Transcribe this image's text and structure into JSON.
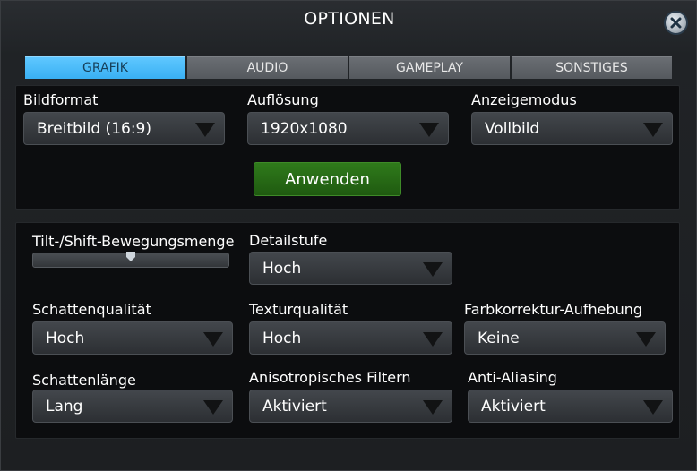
{
  "window": {
    "title": "OPTIONEN"
  },
  "tabs": [
    {
      "label": "GRAFIK",
      "active": true
    },
    {
      "label": "AUDIO",
      "active": false
    },
    {
      "label": "GAMEPLAY",
      "active": false
    },
    {
      "label": "SONSTIGES",
      "active": false
    }
  ],
  "display": {
    "aspect": {
      "label": "Bildformat",
      "value": "Breitbild (16:9)"
    },
    "resolution": {
      "label": "Auflösung",
      "value": "1920x1080"
    },
    "mode": {
      "label": "Anzeigemodus",
      "value": "Vollbild"
    },
    "apply_label": "Anwenden"
  },
  "quality": {
    "tiltshift": {
      "label": "Tilt-/Shift-Bewegungsmenge",
      "fraction": 0.5
    },
    "detail": {
      "label": "Detailstufe",
      "value": "Hoch"
    },
    "shadow_quality": {
      "label": "Schattenqualität",
      "value": "Hoch"
    },
    "texture_quality": {
      "label": "Texturqualität",
      "value": "Hoch"
    },
    "color_correction": {
      "label": "Farbkorrektur-Aufhebung",
      "value": "Keine"
    },
    "shadow_length": {
      "label": "Schattenlänge",
      "value": "Lang"
    },
    "anisotropic": {
      "label": "Anisotropisches Filtern",
      "value": "Aktiviert"
    },
    "antialiasing": {
      "label": "Anti-Aliasing",
      "value": "Aktiviert"
    }
  },
  "colors": {
    "active_tab": "#39b0f3",
    "apply_button": "#2f7a1b",
    "panel_bg": "#0c0d0f"
  },
  "icons": {
    "close": "close-x-icon",
    "dropdown": "triangle-down-icon"
  }
}
